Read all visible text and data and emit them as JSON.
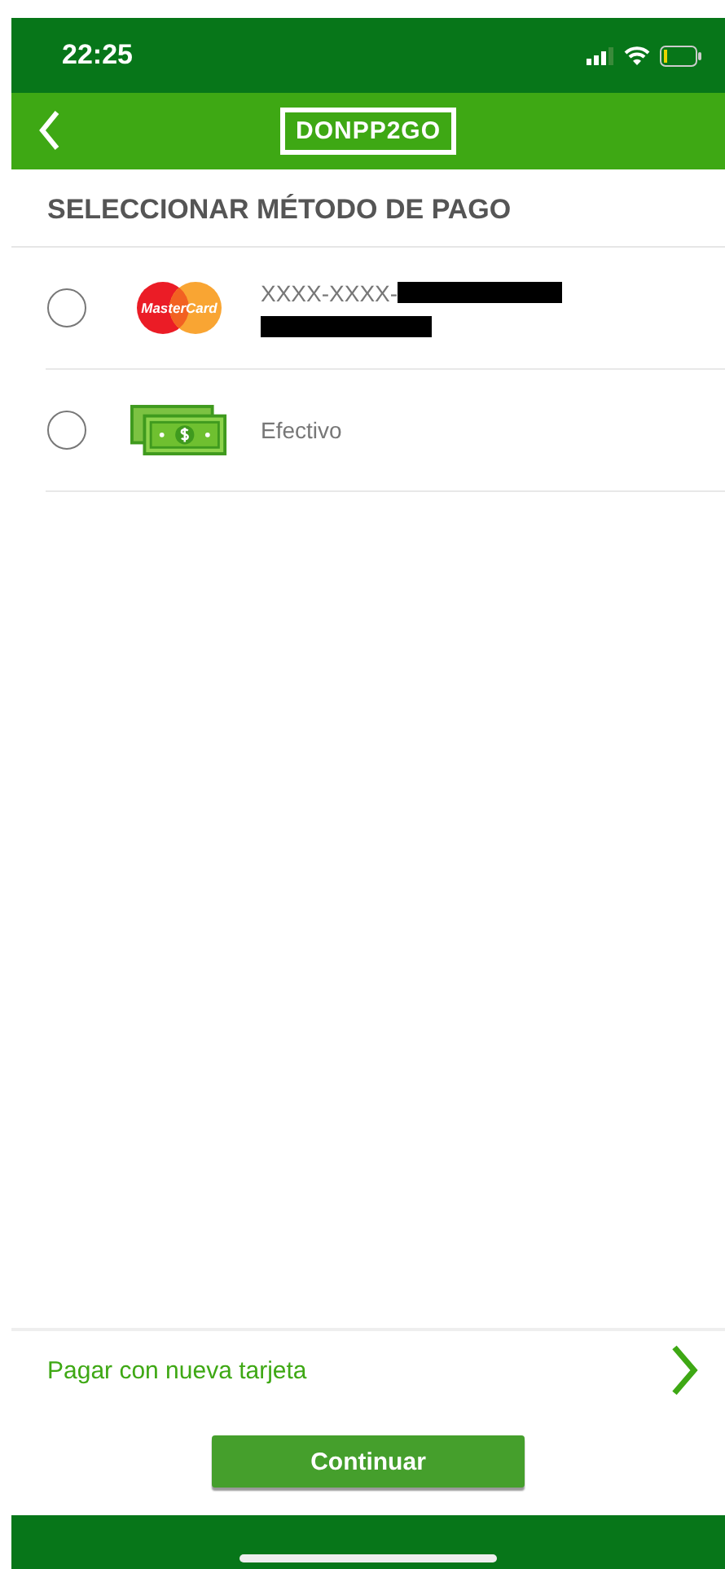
{
  "status_bar": {
    "time": "22:25"
  },
  "header": {
    "logo": "DONPP2GO"
  },
  "title": "SELECCIONAR MÉTODO DE PAGO",
  "methods": [
    {
      "kind": "card",
      "logo_label": "MasterCard",
      "label": "XXXX-XXXX-",
      "selected": false
    },
    {
      "kind": "cash",
      "label": "Efectivo",
      "selected": false
    }
  ],
  "new_card": {
    "label": "Pagar con nueva tarjeta"
  },
  "continue_button": "Continuar"
}
